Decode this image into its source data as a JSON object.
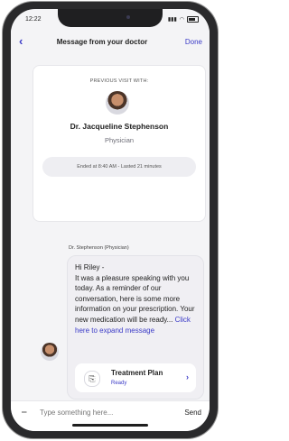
{
  "status": {
    "time": "12:22"
  },
  "nav": {
    "back_icon": "‹",
    "title": "Message from your doctor",
    "done_label": "Done"
  },
  "visit": {
    "label": "PREVIOUS VISIT WITH:",
    "doctor_name": "Dr. Jacqueline Stephenson",
    "doctor_role": "Physician",
    "ended": "Ended at 8:40 AM - Lasted 21 minutes"
  },
  "message": {
    "sender": "Dr. Stephenson (Physician)",
    "greeting": "Hi Riley -",
    "body": "It was a pleasure speaking with you today. As a reminder of our conversation, here is some more information on your prescription. Your new medication will be ready...",
    "link": "Click here to expand message"
  },
  "treatment": {
    "title": "Treatment Plan",
    "sub": "Ready",
    "chevron": "›"
  },
  "composer": {
    "placeholder": "Type something here...",
    "send_label": "Send"
  },
  "icons": [
    "back-icon",
    "doctor-avatar",
    "treatment-plan-icon",
    "chevron-right-icon",
    "paperclip-icon"
  ],
  "colors": {
    "accent": "#3b3bc7",
    "background": "#f4f4f6"
  }
}
